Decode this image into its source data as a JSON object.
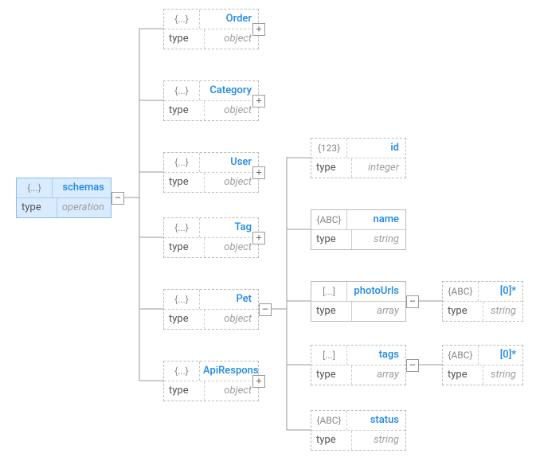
{
  "colors": {
    "accent": "#1e88e5",
    "selected_bg": "#d9ecff",
    "muted": "#9e9e9e"
  },
  "type_label": "type",
  "glyphs": {
    "object": "{...}",
    "integer": "{123}",
    "string": "{ABC}",
    "array": "[...]"
  },
  "toggle": {
    "expand": "+",
    "collapse": "−"
  },
  "nodes": {
    "root": {
      "hint": "object",
      "name": "schemas",
      "typeval": "operation"
    },
    "order": {
      "hint": "object",
      "name": "Order",
      "typeval": "object"
    },
    "category": {
      "hint": "object",
      "name": "Category",
      "typeval": "object"
    },
    "user": {
      "hint": "object",
      "name": "User",
      "typeval": "object"
    },
    "tag": {
      "hint": "object",
      "name": "Tag",
      "typeval": "object"
    },
    "pet": {
      "hint": "object",
      "name": "Pet",
      "typeval": "object"
    },
    "apiresponse": {
      "hint": "object",
      "name": "ApiResponse",
      "typeval": "object"
    },
    "id": {
      "hint": "integer",
      "name": "id",
      "typeval": "integer"
    },
    "pname": {
      "hint": "string",
      "name": "name",
      "typeval": "string"
    },
    "photourls": {
      "hint": "array",
      "name": "photoUrls",
      "typeval": "array"
    },
    "tags": {
      "hint": "array",
      "name": "tags",
      "typeval": "array"
    },
    "status": {
      "hint": "string",
      "name": "status",
      "typeval": "string"
    },
    "photoitem": {
      "hint": "string",
      "name": "[0]*",
      "typeval": "string"
    },
    "tagitem": {
      "hint": "string",
      "name": "[0]*",
      "typeval": "string"
    }
  }
}
